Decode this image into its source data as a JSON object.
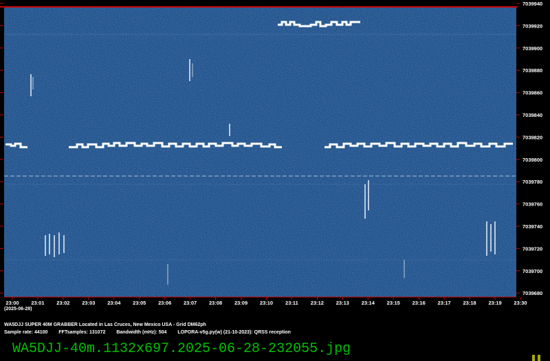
{
  "chart_data": {
    "type": "heatmap",
    "ylim": [
      7039680,
      7039940
    ],
    "y_ticks": [
      "7039940",
      "7039920",
      "7039900",
      "7039880",
      "7039860",
      "7039840",
      "7039820",
      "7039800",
      "7039780",
      "7039760",
      "7039740",
      "7039720",
      "7039700",
      "7039680"
    ],
    "x_ticks": [
      "23:00",
      "23:01",
      "23:02",
      "23:03",
      "23:04",
      "23:05",
      "23:06",
      "23:07",
      "23:08",
      "23:09",
      "23:10",
      "23:11",
      "23:12",
      "23:13",
      "23:14",
      "23:15",
      "23:16",
      "23:17",
      "23:18",
      "23:19",
      "23:30"
    ],
    "date_label": "(2025-06-28)",
    "background_color": "#1e4f87",
    "frame_color": "#cc0000"
  },
  "info": {
    "station": "WA5DJJ SUPER 40M GRABBER Located in Las Cruces, New Mexico USA - Grid DM62ph",
    "sample_rate": "Sample rate: 44100",
    "fft_samples": "FFTsamples: 131072",
    "bandwidth": "Bandwidth (mHz): 504",
    "software": "LOPORA-v5g.py(w) (21-10-2023): QRSS reception"
  },
  "filename": "WA5DJJ-40m.1132x697.2025-06-28-232055.jpg"
}
